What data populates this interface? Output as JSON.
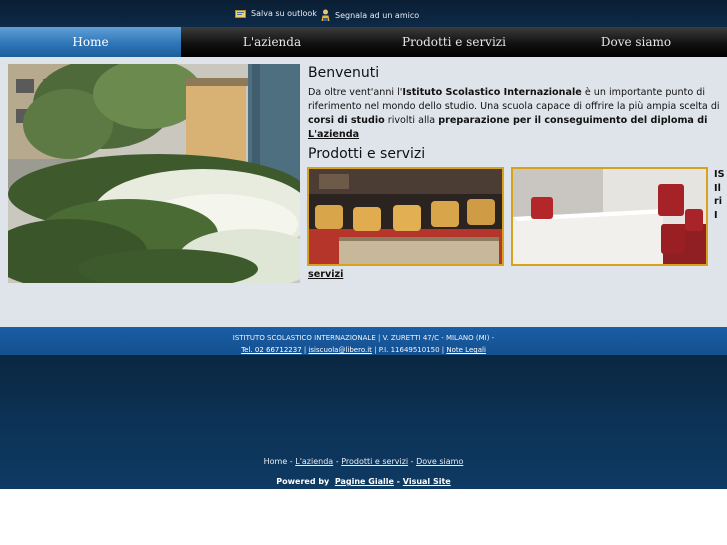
{
  "topbar": {
    "save_outlook": "Salva su outlook",
    "tell_friend": "Segnala ad un amico"
  },
  "nav": [
    {
      "label": "Home",
      "active": true
    },
    {
      "label": "L'azienda",
      "active": false
    },
    {
      "label": "Prodotti e servizi",
      "active": false
    },
    {
      "label": "Dove siamo",
      "active": false
    }
  ],
  "welcome": {
    "title": "Benvenuti",
    "p1": "Da oltre vent'anni l'",
    "bold1": "Istituto Scolastico Internazionale",
    "p2": " è un importante punto di riferimento nel mondo dello studio. Una scuola capace di offrire la più ampia scelta di ",
    "bold2": "corsi di studio",
    "p3": " rivolti alla ",
    "bold3": "preparazione per il conseguimento del diploma di",
    "link": "L'azienda"
  },
  "products": {
    "title": "Prodotti e servizi",
    "side_text": "IS\nIl\nri\nI",
    "link": "servizi"
  },
  "footer": {
    "line1": "ISTITUTO SCOLASTICO INTERNAZIONALE | V. ZURETTI 47/C - MILANO (MI) -",
    "tel": "Tel. 02 66712237",
    "sep1": " | ",
    "email": "isiscuola@libero.it",
    "piva": " | P.I. 11649510150 | ",
    "legal": "Note Legali"
  },
  "bottomnav": {
    "home": "Home",
    "sep": " - ",
    "azienda": "L'azienda",
    "prodotti": "Prodotti e servizi",
    "dove": "Dove siamo"
  },
  "powered": {
    "label": "Powered by",
    "pagine": "Pagine Gialle",
    "dash": " - ",
    "visual": "Visual Site"
  },
  "colors": {
    "nav_active": "#2f76b8",
    "thumb_border": "#d9a21c",
    "footer_blue": "#1a5ea6",
    "footer_dark": "#0c3256"
  }
}
